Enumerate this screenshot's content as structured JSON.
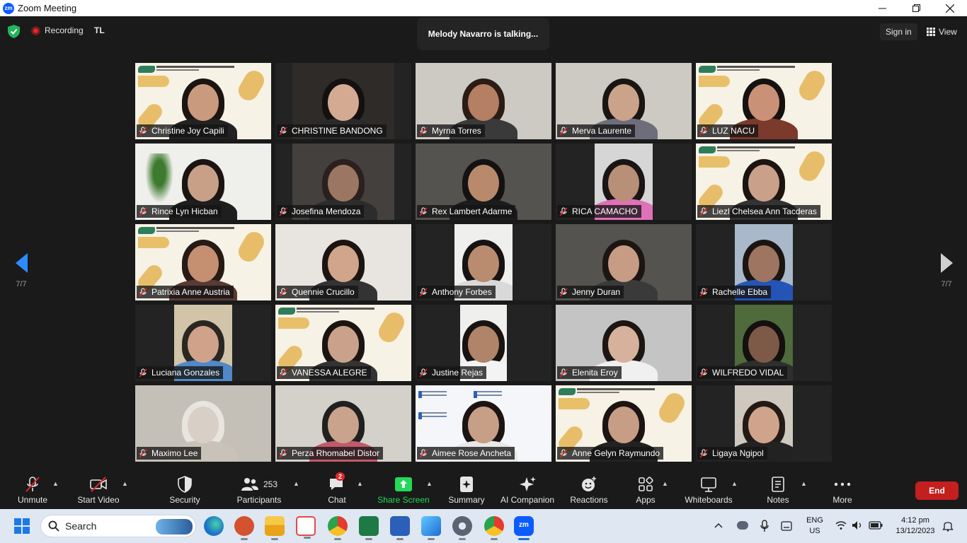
{
  "window": {
    "title": "Zoom Meeting",
    "app_icon_text": "zm",
    "controls": [
      "minimize-icon",
      "restore-icon",
      "close-icon"
    ]
  },
  "topbar": {
    "security_icon": "shield-check-icon",
    "recording_label": "Recording",
    "host_initials": "TL",
    "talking_text": "Melody Navarro is talking...",
    "signin_label": "Sign in",
    "view_label": "View"
  },
  "pager": {
    "left": "7/7",
    "right": "7/7"
  },
  "participants": [
    {
      "name": "Christine Joy Capili",
      "muted": true
    },
    {
      "name": "CHRISTINE BANDONG",
      "muted": true
    },
    {
      "name": "Myrna Torres",
      "muted": true
    },
    {
      "name": "Merva Laurente",
      "muted": true
    },
    {
      "name": "LUZ NACU",
      "muted": true
    },
    {
      "name": "Rince Lyn Hicban",
      "muted": true
    },
    {
      "name": "Josefina Mendoza",
      "muted": true
    },
    {
      "name": "Rex Lambert Adarme",
      "muted": true
    },
    {
      "name": "RICA CAMACHO",
      "muted": true
    },
    {
      "name": "Liezl Chelsea Ann Tacderas",
      "muted": true
    },
    {
      "name": "Patrixia Anne Austria",
      "muted": true
    },
    {
      "name": "Quennie Crucillo",
      "muted": true
    },
    {
      "name": "Anthony Forbes",
      "muted": true
    },
    {
      "name": "Jenny Duran",
      "muted": true
    },
    {
      "name": "Rachelle Ebba",
      "muted": true
    },
    {
      "name": "Luciana Gonzales",
      "muted": true
    },
    {
      "name": "VANESSA ALEGRE",
      "muted": true
    },
    {
      "name": "Justine Rejas",
      "muted": true
    },
    {
      "name": "Elenita Eroy",
      "muted": true
    },
    {
      "name": "WILFREDO VIDAL",
      "muted": true
    },
    {
      "name": "Maximo Lee",
      "muted": true
    },
    {
      "name": "Perza Rhomabel Distor",
      "muted": true
    },
    {
      "name": "Aimee Rose Ancheta",
      "muted": true
    },
    {
      "name": "Anne Gelyn Raymundo",
      "muted": true
    },
    {
      "name": "Ligaya Ngipol",
      "muted": true
    }
  ],
  "toolbar": {
    "unmute": "Unmute",
    "start_video": "Start Video",
    "security": "Security",
    "participants": "Participants",
    "participants_count": "253",
    "chat": "Chat",
    "chat_badge": "2",
    "share_screen": "Share Screen",
    "summary": "Summary",
    "ai_companion": "AI Companion",
    "reactions": "Reactions",
    "apps": "Apps",
    "whiteboards": "Whiteboards",
    "notes": "Notes",
    "more": "More",
    "end": "End"
  },
  "taskbar": {
    "search_label": "Search",
    "apps": [
      "edge-icon",
      "powerpoint-icon",
      "file-explorer-icon",
      "snipping-tool-icon",
      "chrome-icon",
      "excel-icon",
      "word-icon",
      "photos-icon",
      "settings-icon",
      "chrome-profile-icon",
      "zoom-icon"
    ],
    "language_line1": "ENG",
    "language_line2": "US",
    "time": "4:12 pm",
    "date": "13/12/2023"
  },
  "colors": {
    "accent_blue": "#2d8cff",
    "share_green": "#23d959",
    "end_red": "#c41f1f",
    "mute_red": "#e02828"
  }
}
